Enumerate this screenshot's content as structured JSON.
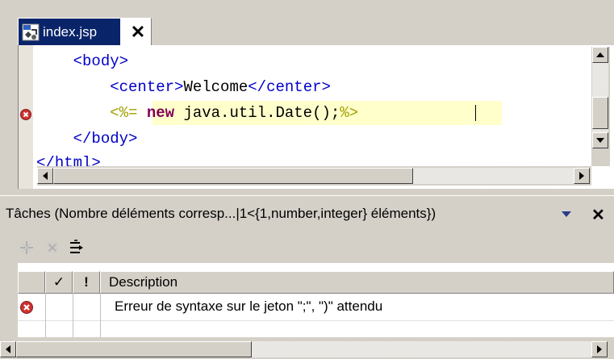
{
  "editor": {
    "tab": {
      "label": "index.jsp",
      "close_glyph": "✕",
      "icon": "jsp-file-icon"
    },
    "lines": [
      {
        "indent": "    ",
        "parts": [
          [
            "tag",
            "<"
          ],
          [
            "tag",
            "body"
          ],
          [
            "tag",
            ">"
          ]
        ]
      },
      {
        "indent": "        ",
        "parts": [
          [
            "tag",
            "<"
          ],
          [
            "tag",
            "center"
          ],
          [
            "tag",
            ">"
          ],
          [
            "text",
            "Welcome"
          ],
          [
            "tag",
            "</"
          ],
          [
            "tag",
            "center"
          ],
          [
            "tag",
            ">"
          ]
        ]
      },
      {
        "indent": "        ",
        "parts": [
          [
            "scriptlet",
            "<%= "
          ],
          [
            "kw",
            "new"
          ],
          [
            "text",
            " java.util.Date();"
          ],
          [
            "scriptlet",
            "%>"
          ]
        ]
      },
      {
        "indent": "    ",
        "parts": [
          [
            "tag",
            "</"
          ],
          [
            "tag",
            "body"
          ],
          [
            "tag",
            ">"
          ]
        ]
      },
      {
        "indent": "",
        "parts": [
          [
            "tag",
            "</"
          ],
          [
            "tag",
            "html"
          ],
          [
            "tag",
            ">"
          ]
        ]
      }
    ],
    "error_marker_line": 3
  },
  "tasks": {
    "title": "Tâches (Nombre déléments corresp...|1<{1,number,integer} éléments})",
    "close_glyph": "✕",
    "toolbar": [
      "add-task-icon",
      "delete-task-icon",
      "filter-icon"
    ],
    "columns": [
      "",
      "✓",
      "!",
      "Description"
    ],
    "rows": [
      {
        "severity": "error",
        "done": "",
        "priority": "",
        "description": "Erreur de syntaxe sur le jeton \";\", \")\" attendu"
      }
    ]
  },
  "colors": {
    "tab_active": "#0a246a",
    "tag": "#0000c8",
    "keyword": "#7f0055",
    "scriptlet": "#a0a000",
    "highlight_line": "#ffffcc",
    "error_red": "#d03030"
  }
}
